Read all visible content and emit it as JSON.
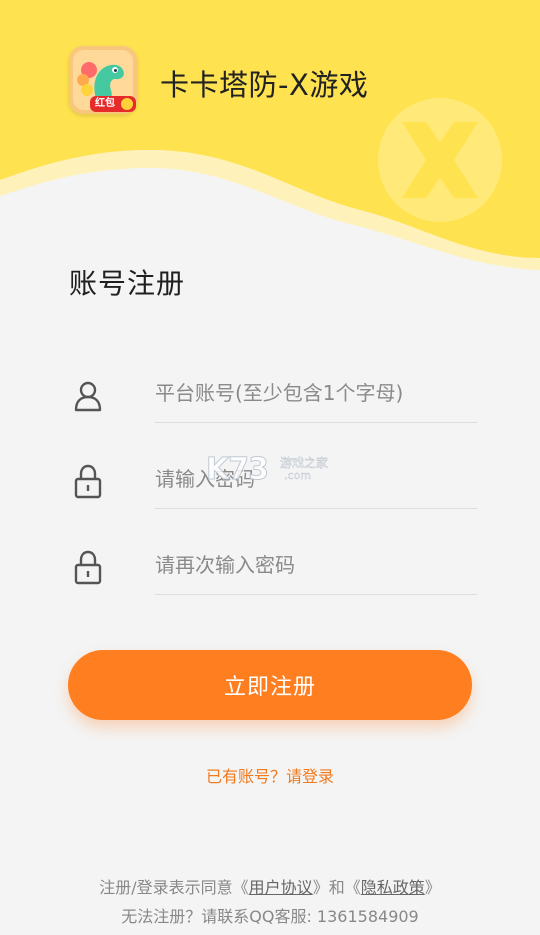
{
  "header": {
    "app_title": "卡卡塔防-X游戏",
    "logo_badge": "红包",
    "logo_icon": "dinosaur-app-logo",
    "bg_color": "#ffe24f"
  },
  "page_title": "账号注册",
  "fields": {
    "account": {
      "placeholder": "平台账号(至少包含1个字母)",
      "icon": "user-icon"
    },
    "password": {
      "placeholder": "请输入密码",
      "icon": "lock-icon"
    },
    "confirm_password": {
      "placeholder": "请再次输入密码",
      "icon": "lock-icon"
    }
  },
  "submit_label": "立即注册",
  "login_link": "已有账号？请登录",
  "agreement": {
    "prefix": "注册/登录表示同意《",
    "user_agreement": "用户协议",
    "middle": "》和《",
    "privacy_policy": "隐私政策",
    "suffix": "》"
  },
  "contact": "无法注册？请联系QQ客服: 1361584909",
  "watermark": {
    "brand": "K73",
    "cn": "游戏之家",
    "com": ".com"
  },
  "colors": {
    "accent": "#ff7e20",
    "header_yellow": "#ffe24f",
    "link_orange": "#f07a1e"
  }
}
